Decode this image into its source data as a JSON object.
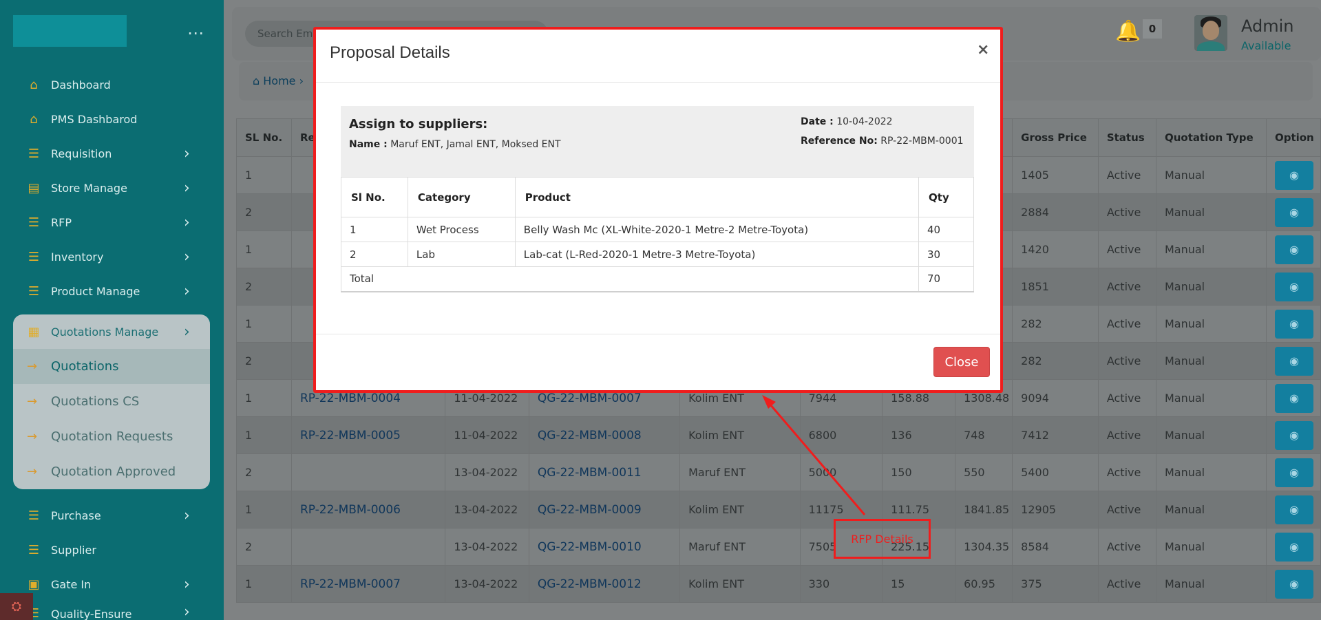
{
  "sidebar": {
    "menu_icon": "more-horizontal-icon",
    "items": [
      {
        "label": "Dashboard",
        "icon": "home-icon",
        "chevron": false
      },
      {
        "label": "PMS Dashbarod",
        "icon": "home-icon",
        "chevron": false
      },
      {
        "label": "Requisition",
        "icon": "list-icon",
        "chevron": true
      },
      {
        "label": "Store Manage",
        "icon": "store-icon",
        "chevron": true
      },
      {
        "label": "RFP",
        "icon": "list-icon",
        "chevron": true
      },
      {
        "label": "Inventory",
        "icon": "list-icon",
        "chevron": true
      },
      {
        "label": "Product Manage",
        "icon": "list-icon",
        "chevron": true
      }
    ],
    "group": {
      "label": "Quotations Manage",
      "icon": "document-icon",
      "children": [
        {
          "label": "Quotations",
          "active": true
        },
        {
          "label": "Quotations CS",
          "active": false
        },
        {
          "label": "Quotation Requests",
          "active": false
        },
        {
          "label": "Quotation Approved",
          "active": false
        }
      ]
    },
    "after_items": [
      {
        "label": "Purchase",
        "icon": "list-icon",
        "chevron": true
      },
      {
        "label": "Supplier",
        "icon": "list-icon",
        "chevron": false
      },
      {
        "label": "Gate In",
        "icon": "gate-icon",
        "chevron": true
      },
      {
        "label": "Quality-Ensure",
        "icon": "list-icon",
        "chevron": true
      }
    ]
  },
  "topbar": {
    "search_placeholder": "Search Em",
    "notification_count": "0",
    "user_name": "Admin",
    "user_status": "Available"
  },
  "breadcrumb": {
    "home": "Home"
  },
  "table": {
    "headers": [
      "SL No.",
      "Re",
      "",
      "",
      "",
      "",
      "",
      "",
      "Gross Price",
      "Status",
      "Quotation Type",
      "Option"
    ],
    "rows": [
      {
        "sl": "1",
        "rfp": "",
        "date": "",
        "qg": "",
        "supplier": "",
        "price": "",
        "vat": "",
        "tax": "",
        "gross": "1405",
        "status": "Active",
        "type": "Manual"
      },
      {
        "sl": "2",
        "rfp": "",
        "date": "",
        "qg": "",
        "supplier": "",
        "price": "",
        "vat": "",
        "tax": "",
        "gross": "2884",
        "status": "Active",
        "type": "Manual"
      },
      {
        "sl": "1",
        "rfp": "",
        "date": "",
        "qg": "",
        "supplier": "",
        "price": "",
        "vat": "",
        "tax": "",
        "gross": "1420",
        "status": "Active",
        "type": "Manual"
      },
      {
        "sl": "2",
        "rfp": "",
        "date": "",
        "qg": "",
        "supplier": "",
        "price": "",
        "vat": "",
        "tax": "",
        "gross": "1851",
        "status": "Active",
        "type": "Manual"
      },
      {
        "sl": "1",
        "rfp": "",
        "date": "",
        "qg": "",
        "supplier": "",
        "price": "",
        "vat": "",
        "tax": "",
        "gross": "282",
        "status": "Active",
        "type": "Manual"
      },
      {
        "sl": "2",
        "rfp": "",
        "date": "",
        "qg": "",
        "supplier": "",
        "price": "",
        "vat": "",
        "tax": "",
        "gross": "282",
        "status": "Active",
        "type": "Manual"
      },
      {
        "sl": "1",
        "rfp": "RP-22-MBM-0004",
        "date": "11-04-2022",
        "qg": "QG-22-MBM-0007",
        "supplier": "Kolim ENT",
        "price": "7944",
        "vat": "158.88",
        "tax": "1308.48",
        "gross": "9094",
        "status": "Active",
        "type": "Manual"
      },
      {
        "sl": "1",
        "rfp": "RP-22-MBM-0005",
        "date": "11-04-2022",
        "qg": "QG-22-MBM-0008",
        "supplier": "Kolim ENT",
        "price": "6800",
        "vat": "136",
        "tax": "748",
        "gross": "7412",
        "status": "Active",
        "type": "Manual"
      },
      {
        "sl": "2",
        "rfp": "",
        "date": "13-04-2022",
        "qg": "QG-22-MBM-0011",
        "supplier": "Maruf ENT",
        "price": "5000",
        "vat": "150",
        "tax": "550",
        "gross": "5400",
        "status": "Active",
        "type": "Manual"
      },
      {
        "sl": "1",
        "rfp": "RP-22-MBM-0006",
        "date": "13-04-2022",
        "qg": "QG-22-MBM-0009",
        "supplier": "Kolim ENT",
        "price": "11175",
        "vat": "111.75",
        "tax": "1841.85",
        "gross": "12905",
        "status": "Active",
        "type": "Manual"
      },
      {
        "sl": "2",
        "rfp": "",
        "date": "13-04-2022",
        "qg": "QG-22-MBM-0010",
        "supplier": "Maruf ENT",
        "price": "7505",
        "vat": "225.15",
        "tax": "1304.35",
        "gross": "8584",
        "status": "Active",
        "type": "Manual"
      },
      {
        "sl": "1",
        "rfp": "RP-22-MBM-0007",
        "date": "13-04-2022",
        "qg": "QG-22-MBM-0012",
        "supplier": "Kolim ENT",
        "price": "330",
        "vat": "15",
        "tax": "60.95",
        "gross": "375",
        "status": "Active",
        "type": "Manual"
      }
    ]
  },
  "modal": {
    "title": "Proposal Details",
    "close_symbol": "×",
    "assign_heading": "Assign to suppliers:",
    "name_label": "Name :",
    "name_value": "Maruf ENT, Jamal ENT, Moksed ENT",
    "date_label": "Date :",
    "date_value": "10-04-2022",
    "ref_label": "Reference No:",
    "ref_value": "RP-22-MBM-0001",
    "columns": [
      "Sl No.",
      "Category",
      "Product",
      "Qty"
    ],
    "rows": [
      {
        "sl": "1",
        "category": "Wet Process",
        "product": "Belly Wash Mc (XL-White-2020-1 Metre-2 Metre-Toyota)",
        "qty": "40"
      },
      {
        "sl": "2",
        "category": "Lab",
        "product": "Lab-cat (L-Red-2020-1 Metre-3 Metre-Toyota)",
        "qty": "30"
      }
    ],
    "total_label": "Total",
    "total_qty": "70",
    "close_button": "Close"
  },
  "annotation": {
    "label": "RFP Details",
    "color": "#ef1d1d"
  }
}
